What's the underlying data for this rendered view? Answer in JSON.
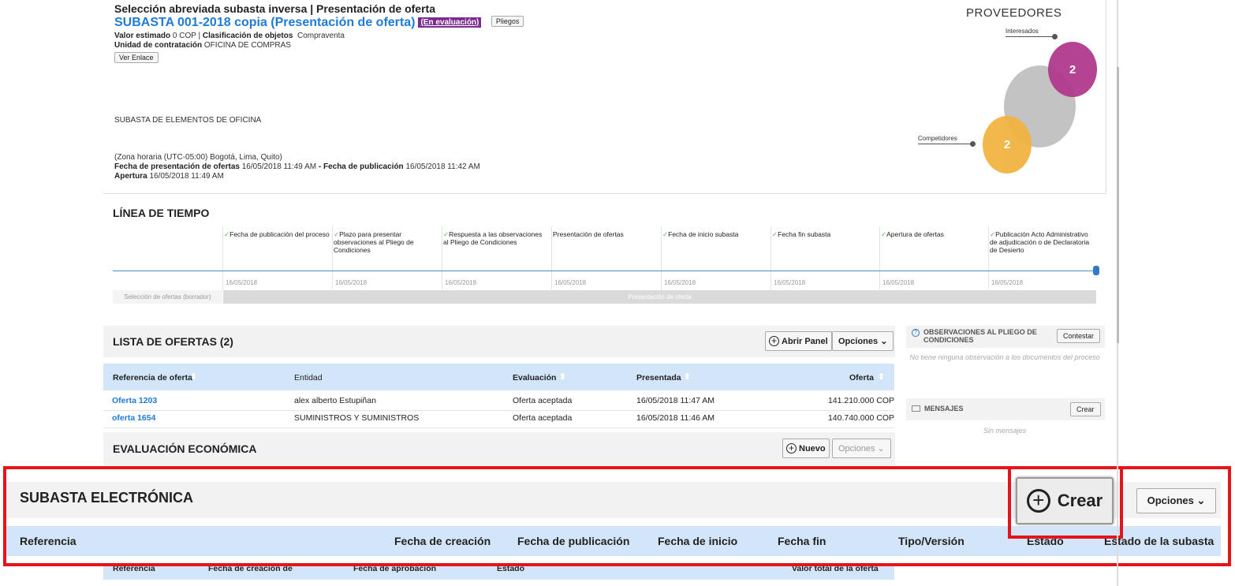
{
  "header": {
    "title": "Selección abreviada subasta inversa | Presentación de oferta",
    "subtitle": "SUBASTA 001-2018 copia (Presentación de oferta)",
    "status_badge": "(En evaluación)",
    "pliegos_button": "Pliegos",
    "valor_label": "Valor estimado",
    "valor_value": "0 COP",
    "clasif_label": "Clasificación de objetos",
    "clasif_value": "Compraventa",
    "unidad_label": "Unidad de contratación",
    "unidad_value": "OFICINA DE COMPRAS",
    "ver_enlace_button": "Ver Enlace",
    "description": "SUBASTA DE ELEMENTOS DE OFICINA",
    "timezone": "(Zona horaria (UTC-05:00) Bogotá, Lima, Quito)",
    "fecha_presentacion_label": "Fecha de presentación de ofertas",
    "fecha_presentacion_value": "16/05/2018 11:49 AM",
    "sep": " - ",
    "fecha_publicacion_label": "Fecha de publicación",
    "fecha_publicacion_value": "16/05/2018 11:42 AM",
    "apertura_label": "Apertura",
    "apertura_value": "16/05/2018 11:49 AM"
  },
  "proveedores": {
    "title": "PROVEEDORES",
    "interesados_label": "Interesados",
    "interesados_count": "2",
    "competidores_label": "Competidores",
    "competidores_count": "2",
    "colors": {
      "interesados": "#b2398f",
      "competidores": "#f2b441",
      "neutral": "#bdbdbd"
    }
  },
  "timeline": {
    "title": "LÍNEA DE TIEMPO",
    "steps": [
      {
        "label": "Fecha de publicación del proceso",
        "date": "16/05/2018",
        "check": "✓"
      },
      {
        "label": "Plazo para presentar observaciones al Pliego de Condiciones",
        "date": "16/05/2018",
        "check": "✓"
      },
      {
        "label": "Respuesta a las observaciones al Pliego de Condiciones",
        "date": "16/05/2018",
        "check": "✓"
      },
      {
        "label": "Presentación de ofertas",
        "date": "16/05/2018",
        "check": ""
      },
      {
        "label": "Fecha de inicio subasta",
        "date": "16/05/2018",
        "check": "✓"
      },
      {
        "label": "Fecha fin subasta",
        "date": "16/05/2018",
        "check": "✓"
      },
      {
        "label": "Apertura de ofertas",
        "date": "16/05/2018",
        "check": "✓"
      },
      {
        "label": "Publicación Acto Administrativo de adjudicación o de Declaratoria de Desierto",
        "date": "16/05/2018",
        "check": "✓"
      }
    ],
    "phase_left": "Selección de ofertas (borrador)",
    "phase_main": "Presentación de oferta"
  },
  "ofertas": {
    "title": "LISTA DE OFERTAS (2)",
    "abrir_panel": "Abrir Panel",
    "opciones": "Opciones",
    "columns": [
      "Referencia de oferta",
      "Entidad",
      "Evaluación",
      "Presentada",
      "Oferta"
    ],
    "rows": [
      {
        "ref": "Oferta 1203",
        "entidad": "alex alberto Estupiñan",
        "evaluacion": "Oferta aceptada",
        "presentada": "16/05/2018 11:47 AM",
        "oferta": "141.210.000 COP"
      },
      {
        "ref": "oferta 1654",
        "entidad": "SUMINISTROS Y SUMINISTROS",
        "evaluacion": "Oferta aceptada",
        "presentada": "16/05/2018 11:46 AM",
        "oferta": "140.740.000 COP"
      }
    ]
  },
  "evaluacion": {
    "title": "EVALUACIÓN ECONÓMICA",
    "nuevo": "Nuevo",
    "opciones": "Opciones",
    "columns": [
      "Referencia",
      "Fecha de creación de",
      "Fecha de aprobación",
      "Estado",
      "Valor total de la oferta"
    ]
  },
  "side": {
    "obs_title": "OBSERVACIONES AL PLIEGO DE CONDICIONES",
    "contestar": "Contestar",
    "obs_empty": "No tiene ninguna observación a los documentos del proceso",
    "msg_title": "MENSAJES",
    "crear": "Crear",
    "msg_empty": "Sin mensajes"
  },
  "subasta": {
    "title": "SUBASTA ELECTRÓNICA",
    "crear": "Crear",
    "opciones": "Opciones",
    "columns": [
      "Referencia",
      "Fecha de creación",
      "Fecha de publicación",
      "Fecha de inicio",
      "Fecha fin",
      "Tipo/Versión",
      "Estado",
      "Estado de la subasta"
    ]
  }
}
